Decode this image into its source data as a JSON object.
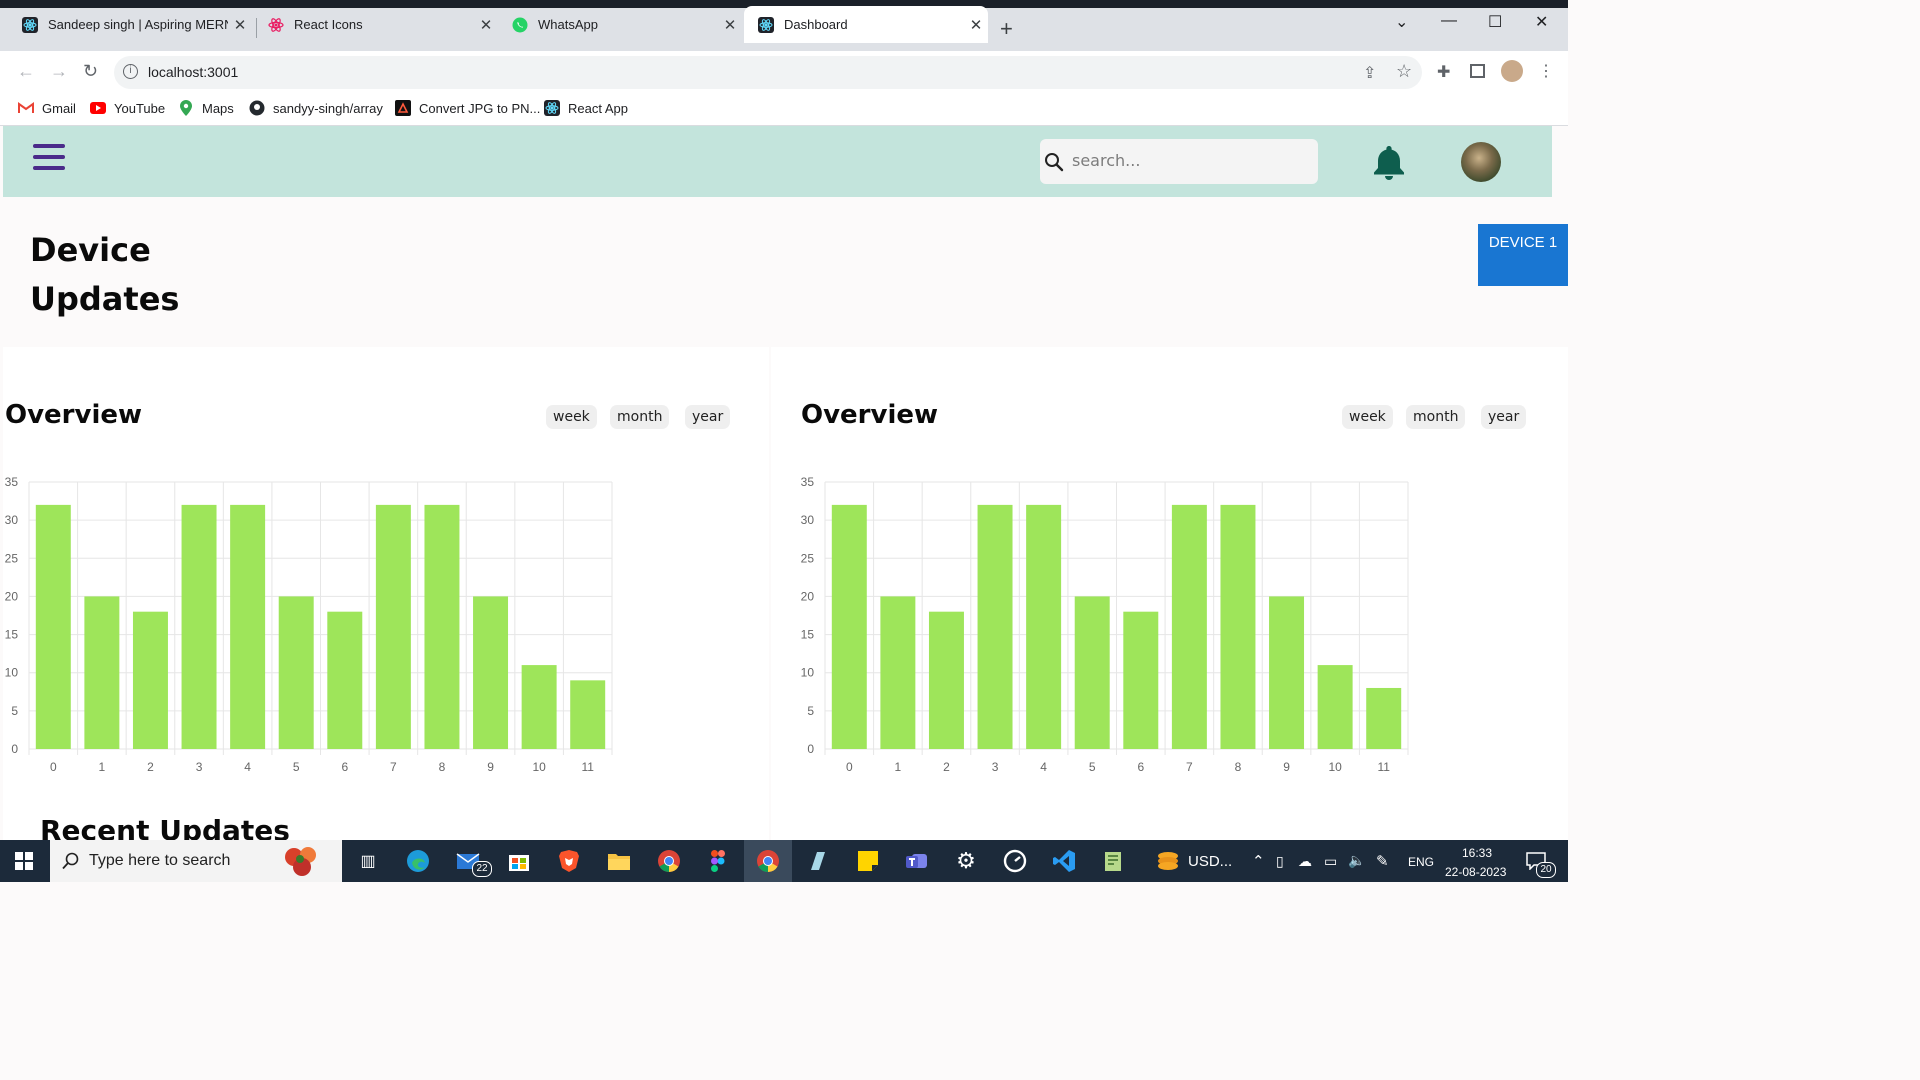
{
  "browser": {
    "tabs": [
      {
        "title": "Sandeep singh | Aspiring MERN S",
        "icon": "react-icon"
      },
      {
        "title": "React Icons",
        "icon": "react-icons-icon"
      },
      {
        "title": "WhatsApp",
        "icon": "whatsapp-icon"
      },
      {
        "title": "Dashboard",
        "icon": "react-icon",
        "active": true
      }
    ],
    "url": "localhost:3001",
    "bookmarks": [
      {
        "label": "Gmail",
        "icon": "gmail-icon"
      },
      {
        "label": "YouTube",
        "icon": "youtube-icon"
      },
      {
        "label": "Maps",
        "icon": "maps-icon"
      },
      {
        "label": "sandyy-singh/array",
        "icon": "github-icon"
      },
      {
        "label": "Convert JPG to PN...",
        "icon": "convert-icon"
      },
      {
        "label": "React App",
        "icon": "react-icon"
      }
    ]
  },
  "header": {
    "search_placeholder": "search...",
    "colors": {
      "bar": "#c3e4dc",
      "menu": "#4a2a8a",
      "bell": "#0e5e4e"
    }
  },
  "page": {
    "title": "Device Updates",
    "device_button": "DEVICE 1",
    "recent_title": "Recent Updates"
  },
  "overview_left": {
    "title": "Overview",
    "filters": [
      "week",
      "month",
      "year"
    ]
  },
  "overview_right": {
    "title": "Overview",
    "filters": [
      "week",
      "month",
      "year"
    ]
  },
  "chart_data": [
    {
      "type": "bar",
      "categories": [
        "0",
        "1",
        "2",
        "3",
        "4",
        "5",
        "6",
        "7",
        "8",
        "9",
        "10",
        "11"
      ],
      "values": [
        32,
        20,
        18,
        32,
        32,
        20,
        18,
        32,
        32,
        20,
        11,
        9
      ],
      "ylim": [
        0,
        35
      ],
      "yticks": [
        0,
        5,
        10,
        15,
        20,
        25,
        30,
        35
      ],
      "grid": true,
      "color": "#9ee55a"
    },
    {
      "type": "bar",
      "categories": [
        "0",
        "1",
        "2",
        "3",
        "4",
        "5",
        "6",
        "7",
        "8",
        "9",
        "10",
        "11"
      ],
      "values": [
        32,
        20,
        18,
        32,
        32,
        20,
        18,
        32,
        32,
        20,
        11,
        8
      ],
      "ylim": [
        0,
        35
      ],
      "yticks": [
        0,
        5,
        10,
        15,
        20,
        25,
        30,
        35
      ],
      "grid": true,
      "color": "#9ee55a"
    }
  ],
  "taskbar": {
    "search_placeholder": "Type here to search",
    "mail_badge": "22",
    "tray_label": "USD...",
    "language": "ENG",
    "time": "16:33",
    "date": "22-08-2023",
    "notification_count": "20"
  }
}
